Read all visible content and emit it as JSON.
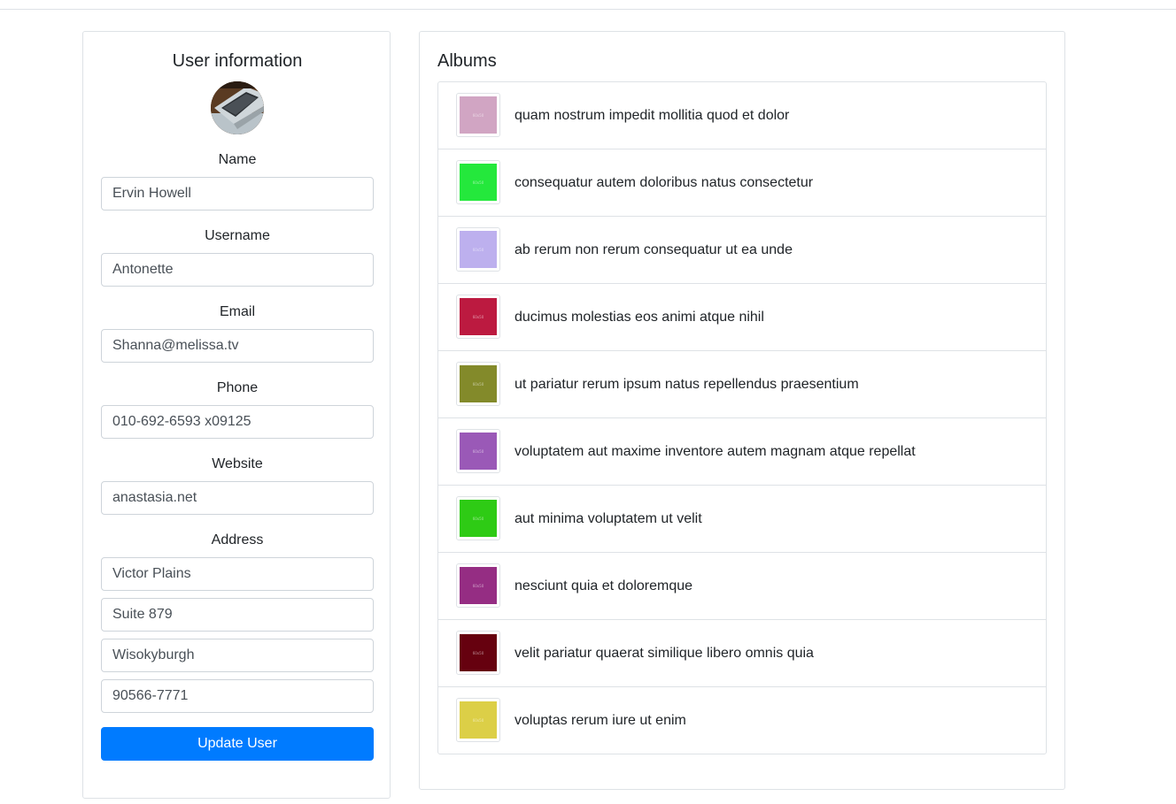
{
  "user_panel": {
    "title": "User information",
    "avatar_icon": "laptop-photo",
    "fields": [
      {
        "label": "Name",
        "value": "Ervin Howell"
      },
      {
        "label": "Username",
        "value": "Antonette"
      },
      {
        "label": "Email",
        "value": "Shanna@melissa.tv"
      },
      {
        "label": "Phone",
        "value": "010-692-6593 x09125"
      },
      {
        "label": "Website",
        "value": "anastasia.net"
      }
    ],
    "address": {
      "label": "Address",
      "street": "Victor Plains",
      "suite": "Suite 879",
      "city": "Wisokyburgh",
      "zipcode": "90566-7771"
    },
    "update_button_label": "Update User"
  },
  "albums_panel": {
    "title": "Albums",
    "albums": [
      {
        "title": "quam nostrum impedit mollitia quod et dolor",
        "thumb_color": "#d1a5c3",
        "thumb_text": "60x50"
      },
      {
        "title": "consequatur autem doloribus natus consectetur",
        "thumb_color": "#24e83c",
        "thumb_text": "60x50"
      },
      {
        "title": "ab rerum non rerum consequatur ut ea unde",
        "thumb_color": "#bdb0ee",
        "thumb_text": "60x50"
      },
      {
        "title": "ducimus molestias eos animi atque nihil",
        "thumb_color": "#bc1a40",
        "thumb_text": "60x50"
      },
      {
        "title": "ut pariatur rerum ipsum natus repellendus praesentium",
        "thumb_color": "#838a2a",
        "thumb_text": "60x50"
      },
      {
        "title": "voluptatem aut maxime inventore autem magnam atque repellat",
        "thumb_color": "#9a59b7",
        "thumb_text": "60x50"
      },
      {
        "title": "aut minima voluptatem ut velit",
        "thumb_color": "#2ecb15",
        "thumb_text": "60x50"
      },
      {
        "title": "nesciunt quia et doloremque",
        "thumb_color": "#952d83",
        "thumb_text": "60x50"
      },
      {
        "title": "velit pariatur quaerat similique libero omnis quia",
        "thumb_color": "#66010f",
        "thumb_text": "60x50"
      },
      {
        "title": "voluptas rerum iure ut enim",
        "thumb_color": "#dccf47",
        "thumb_text": "60x50"
      }
    ]
  }
}
